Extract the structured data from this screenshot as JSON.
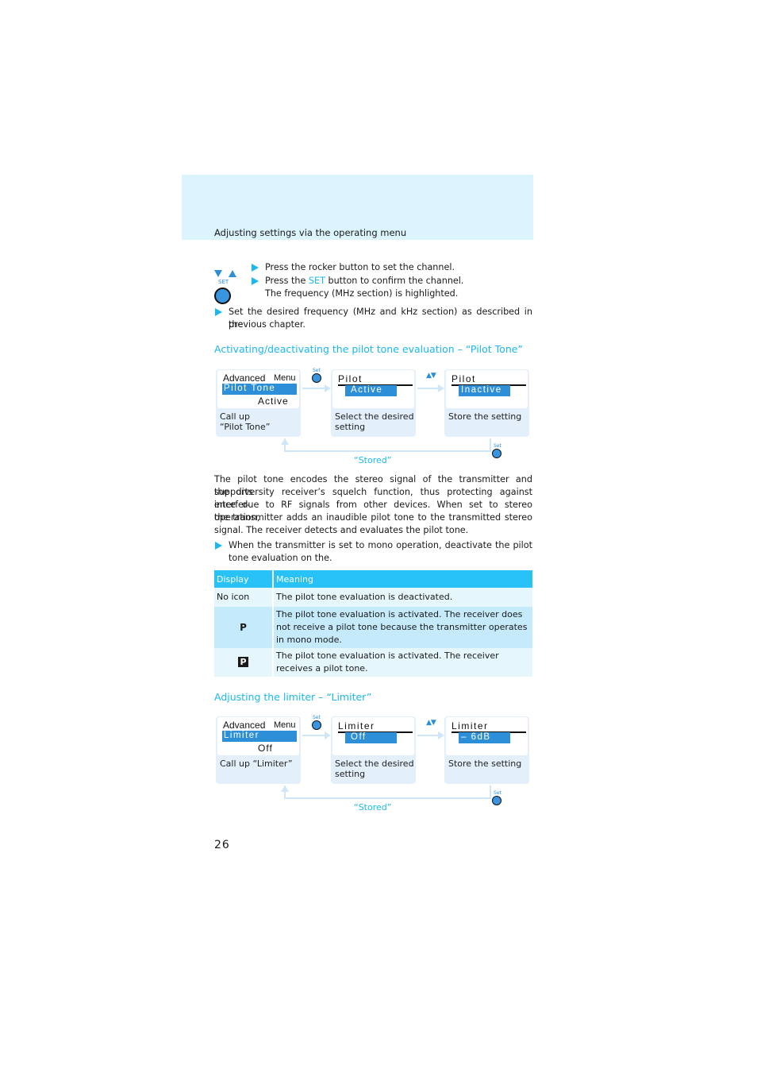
{
  "header": {
    "title": "Adjusting settings via the operating menu"
  },
  "intro": {
    "icons": {
      "rocker": "rocker-down-up-icon",
      "set_label": "SET",
      "set_button": "set-button-icon"
    },
    "steps": [
      "Press the rocker button to set the channel.",
      "Press the ",
      "SET",
      " button to confirm the channel."
    ],
    "result": "The frequency (MHz section) is highlighted.",
    "instruction_line1": "Set the desired frequency (MHz and kHz section) as described in the",
    "instruction_line2": "previous chapter."
  },
  "pilot_section": {
    "heading": "Activating/deactivating the pilot tone evaluation – “Pilot Tone”",
    "flow": {
      "set_label": "Set",
      "updown_label": "▲▼",
      "stored_label": "“Stored”",
      "steps": [
        {
          "menu_title": "Advanced",
          "menu_word": "Menu",
          "selected": "Pilot Tone",
          "value": "Active",
          "caption_line1": "Call up",
          "caption_line2": "“Pilot Tone”"
        },
        {
          "title": "Pilot",
          "selected": "Active",
          "caption_line1": "Select the desired",
          "caption_line2": "setting"
        },
        {
          "title": "Pilot",
          "selected": "Inactive",
          "caption_line1": "Store the setting",
          "caption_line2": ""
        }
      ]
    },
    "paragraph": [
      "The pilot tone encodes the stereo signal of the transmitter and supports",
      "the diversity receiver’s squelch function, thus protecting against interfer-",
      "ence due to RF signals from other devices. When set to stereo operation,",
      "the transmitter adds an inaudible pilot tone to the transmitted stereo",
      "signal. The receiver detects and evaluates the pilot tone."
    ],
    "instruction_line1": "When the transmitter is set to mono operation, deactivate the pilot",
    "instruction_line2": "tone evaluation on the.",
    "table": {
      "headers": [
        "Display",
        "Meaning"
      ],
      "rows": [
        {
          "display": "No icon",
          "meaning": "The pilot tone evaluation is deactivated."
        },
        {
          "display": "P",
          "meaning": "The pilot tone evaluation is activated. The receiver does not receive a pilot tone because the transmitter operates in mono mode."
        },
        {
          "display": "P",
          "meaning": "The pilot tone evaluation is activated. The receiver receives a pilot tone."
        }
      ]
    }
  },
  "limiter_section": {
    "heading": "Adjusting the limiter – “Limiter”",
    "flow": {
      "set_label": "Set",
      "updown_label": "▲▼",
      "stored_label": "“Stored”",
      "steps": [
        {
          "menu_title": "Advanced",
          "menu_word": "Menu",
          "selected": "Limiter",
          "value": "Off",
          "caption_line1": "Call up “Limiter”",
          "caption_line2": ""
        },
        {
          "title": "Limiter",
          "selected": "Off",
          "caption_line1": "Select the desired",
          "caption_line2": "setting"
        },
        {
          "title": "Limiter",
          "selected": "– 6dB",
          "caption_line1": "Store the setting",
          "caption_line2": ""
        }
      ]
    }
  },
  "page_number": "26"
}
